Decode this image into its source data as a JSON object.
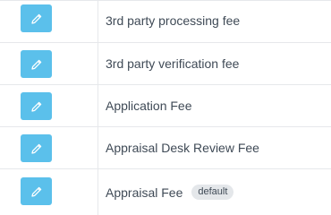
{
  "fees": [
    {
      "edit_icon": "pencil-icon",
      "name": "3rd party processing fee",
      "badge": ""
    },
    {
      "edit_icon": "pencil-icon",
      "name": "3rd party verification fee",
      "badge": ""
    },
    {
      "edit_icon": "pencil-icon",
      "name": "Application Fee",
      "badge": ""
    },
    {
      "edit_icon": "pencil-icon",
      "name": "Appraisal Desk Review Fee",
      "badge": ""
    },
    {
      "edit_icon": "pencil-icon",
      "name": "Appraisal Fee",
      "badge": "default"
    }
  ],
  "colors": {
    "edit_button": "#5bc0eb",
    "text": "#3f4a56",
    "border": "#e6e8eb",
    "badge_bg": "#e4e7ea"
  }
}
